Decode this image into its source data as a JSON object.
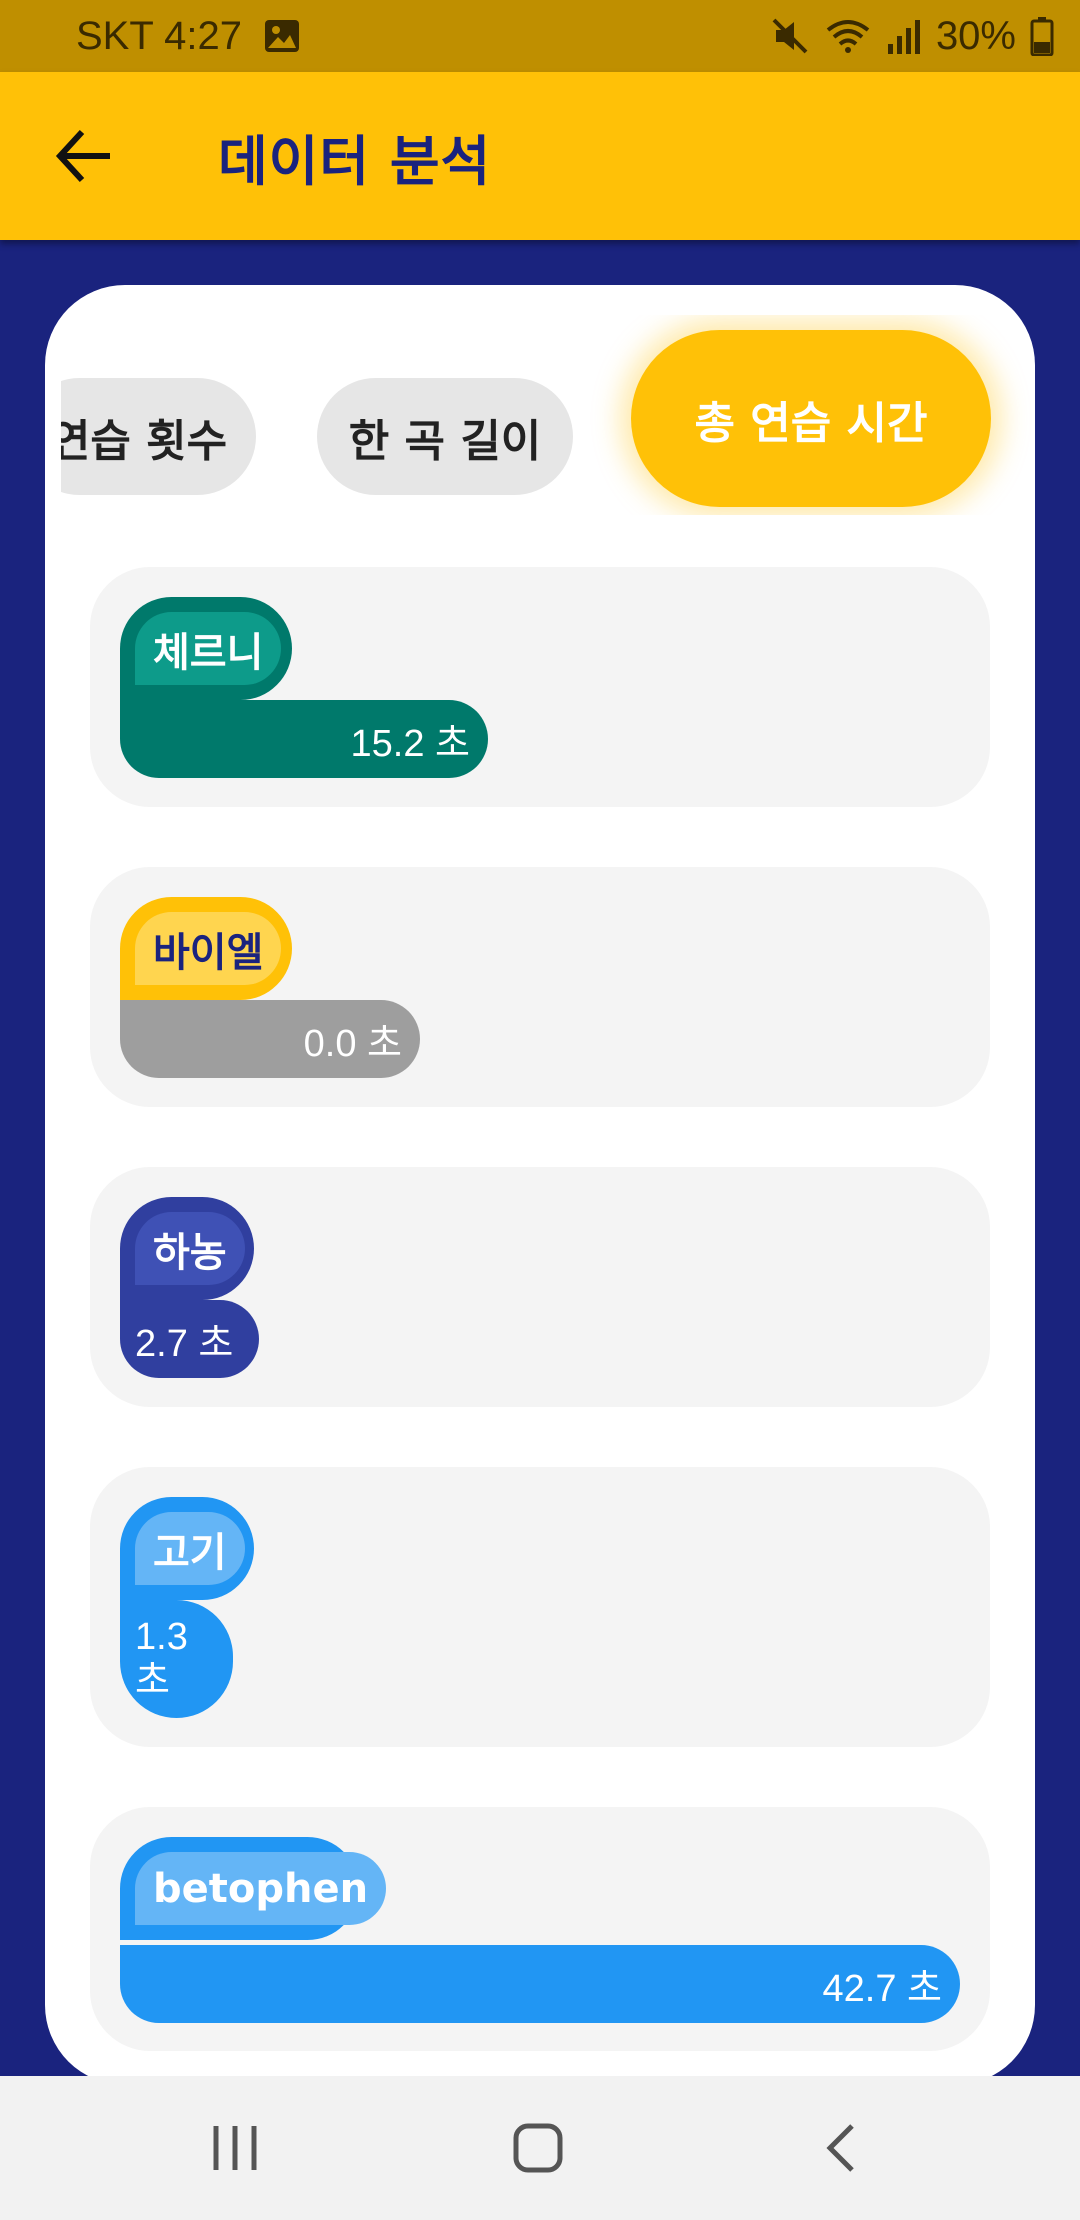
{
  "status_bar": {
    "carrier_time": "SKT 4:27",
    "battery": "30%",
    "icons": [
      "image-icon",
      "mute-icon",
      "wifi-icon",
      "signal-icon",
      "battery-icon"
    ]
  },
  "app_bar": {
    "title": "데이터 분석",
    "back_icon": "arrow-left-icon"
  },
  "tabs": [
    {
      "label": "연습 횟수",
      "selected": false
    },
    {
      "label": "한 곡 길이",
      "selected": false
    },
    {
      "label": "총 연습 시간",
      "selected": true
    }
  ],
  "items": [
    {
      "name": "체르니",
      "value": "15.2 초",
      "seconds": 15.2,
      "color": "#00796b",
      "inner_color": "#0d9b8a",
      "text_color": "#ffffff",
      "bar_color": "#00796b"
    },
    {
      "name": "바이엘",
      "value": "0.0 초",
      "seconds": 0.0,
      "color": "#ffc107",
      "inner_color": "#ffd54f",
      "text_color": "#1a237e",
      "bar_color": "#9e9e9e"
    },
    {
      "name": "하농",
      "value": "2.7 초",
      "seconds": 2.7,
      "color": "#303f9f",
      "inner_color": "#3f51b5",
      "text_color": "#ffffff",
      "bar_color": "#303f9f"
    },
    {
      "name": "고기",
      "value": "1.3 초",
      "seconds": 1.3,
      "color": "#2196f3",
      "inner_color": "#64b5f6",
      "text_color": "#ffffff",
      "bar_color": "#2196f3"
    },
    {
      "name": "betophen",
      "value": "42.7 초",
      "seconds": 42.7,
      "color": "#2196f3",
      "inner_color": "#64b5f6",
      "text_color": "#ffffff",
      "bar_color": "#2196f3"
    }
  ],
  "colors": {
    "primary": "#ffc107",
    "status_bar": "#bf8f00",
    "background": "#1a237e",
    "card": "#ffffff"
  },
  "nav": {
    "recent_icon": "recent-apps-icon",
    "home_icon": "home-icon",
    "back_icon": "back-icon"
  }
}
